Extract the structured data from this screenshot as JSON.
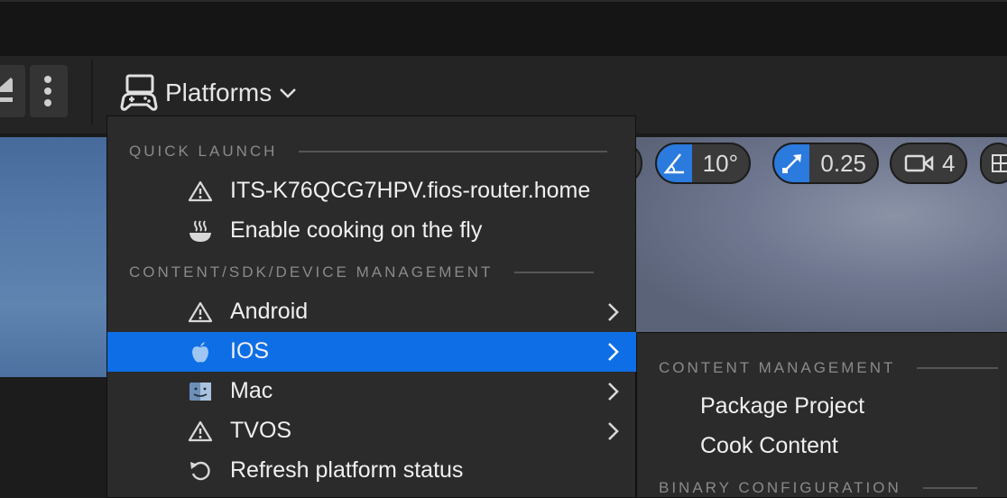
{
  "toolbar": {
    "platforms_label": "Platforms"
  },
  "viewport": {
    "rotation_snap_value": "10°",
    "scale_snap_value": "0.25",
    "camera_speed_value": "4"
  },
  "menu": {
    "quick_launch_heading": "QUICK LAUNCH",
    "quick_launch_items": [
      {
        "label": "ITS-K76QCG7HPV.fios-router.home",
        "icon": "warning-icon"
      },
      {
        "label": "Enable cooking on the fly",
        "icon": "cooking-bowl-icon"
      }
    ],
    "device_heading": "CONTENT/SDK/DEVICE MANAGEMENT",
    "platform_items": [
      {
        "label": "Android",
        "icon": "warning-icon"
      },
      {
        "label": "IOS",
        "icon": "apple-icon",
        "selected": true
      },
      {
        "label": "Mac",
        "icon": "mac-finder-icon"
      },
      {
        "label": "TVOS",
        "icon": "warning-icon"
      }
    ],
    "refresh_label": "Refresh platform status"
  },
  "submenu": {
    "content_heading": "CONTENT MANAGEMENT",
    "items": [
      "Package Project",
      "Cook Content"
    ],
    "binary_heading": "BINARY CONFIGURATION"
  },
  "colors": {
    "accent": "#0e6ee6",
    "menu_bg": "#2b2b2b",
    "toolbar_bg": "#242424"
  }
}
